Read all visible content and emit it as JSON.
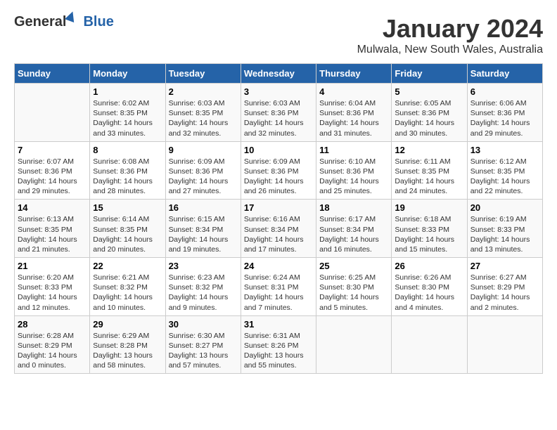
{
  "header": {
    "logo_general": "General",
    "logo_blue": "Blue",
    "title": "January 2024",
    "subtitle": "Mulwala, New South Wales, Australia"
  },
  "columns": [
    "Sunday",
    "Monday",
    "Tuesday",
    "Wednesday",
    "Thursday",
    "Friday",
    "Saturday"
  ],
  "weeks": [
    [
      {
        "day": "",
        "info": ""
      },
      {
        "day": "1",
        "info": "Sunrise: 6:02 AM\nSunset: 8:35 PM\nDaylight: 14 hours\nand 33 minutes."
      },
      {
        "day": "2",
        "info": "Sunrise: 6:03 AM\nSunset: 8:35 PM\nDaylight: 14 hours\nand 32 minutes."
      },
      {
        "day": "3",
        "info": "Sunrise: 6:03 AM\nSunset: 8:36 PM\nDaylight: 14 hours\nand 32 minutes."
      },
      {
        "day": "4",
        "info": "Sunrise: 6:04 AM\nSunset: 8:36 PM\nDaylight: 14 hours\nand 31 minutes."
      },
      {
        "day": "5",
        "info": "Sunrise: 6:05 AM\nSunset: 8:36 PM\nDaylight: 14 hours\nand 30 minutes."
      },
      {
        "day": "6",
        "info": "Sunrise: 6:06 AM\nSunset: 8:36 PM\nDaylight: 14 hours\nand 29 minutes."
      }
    ],
    [
      {
        "day": "7",
        "info": "Sunrise: 6:07 AM\nSunset: 8:36 PM\nDaylight: 14 hours\nand 29 minutes."
      },
      {
        "day": "8",
        "info": "Sunrise: 6:08 AM\nSunset: 8:36 PM\nDaylight: 14 hours\nand 28 minutes."
      },
      {
        "day": "9",
        "info": "Sunrise: 6:09 AM\nSunset: 8:36 PM\nDaylight: 14 hours\nand 27 minutes."
      },
      {
        "day": "10",
        "info": "Sunrise: 6:09 AM\nSunset: 8:36 PM\nDaylight: 14 hours\nand 26 minutes."
      },
      {
        "day": "11",
        "info": "Sunrise: 6:10 AM\nSunset: 8:36 PM\nDaylight: 14 hours\nand 25 minutes."
      },
      {
        "day": "12",
        "info": "Sunrise: 6:11 AM\nSunset: 8:35 PM\nDaylight: 14 hours\nand 24 minutes."
      },
      {
        "day": "13",
        "info": "Sunrise: 6:12 AM\nSunset: 8:35 PM\nDaylight: 14 hours\nand 22 minutes."
      }
    ],
    [
      {
        "day": "14",
        "info": "Sunrise: 6:13 AM\nSunset: 8:35 PM\nDaylight: 14 hours\nand 21 minutes."
      },
      {
        "day": "15",
        "info": "Sunrise: 6:14 AM\nSunset: 8:35 PM\nDaylight: 14 hours\nand 20 minutes."
      },
      {
        "day": "16",
        "info": "Sunrise: 6:15 AM\nSunset: 8:34 PM\nDaylight: 14 hours\nand 19 minutes."
      },
      {
        "day": "17",
        "info": "Sunrise: 6:16 AM\nSunset: 8:34 PM\nDaylight: 14 hours\nand 17 minutes."
      },
      {
        "day": "18",
        "info": "Sunrise: 6:17 AM\nSunset: 8:34 PM\nDaylight: 14 hours\nand 16 minutes."
      },
      {
        "day": "19",
        "info": "Sunrise: 6:18 AM\nSunset: 8:33 PM\nDaylight: 14 hours\nand 15 minutes."
      },
      {
        "day": "20",
        "info": "Sunrise: 6:19 AM\nSunset: 8:33 PM\nDaylight: 14 hours\nand 13 minutes."
      }
    ],
    [
      {
        "day": "21",
        "info": "Sunrise: 6:20 AM\nSunset: 8:33 PM\nDaylight: 14 hours\nand 12 minutes."
      },
      {
        "day": "22",
        "info": "Sunrise: 6:21 AM\nSunset: 8:32 PM\nDaylight: 14 hours\nand 10 minutes."
      },
      {
        "day": "23",
        "info": "Sunrise: 6:23 AM\nSunset: 8:32 PM\nDaylight: 14 hours\nand 9 minutes."
      },
      {
        "day": "24",
        "info": "Sunrise: 6:24 AM\nSunset: 8:31 PM\nDaylight: 14 hours\nand 7 minutes."
      },
      {
        "day": "25",
        "info": "Sunrise: 6:25 AM\nSunset: 8:30 PM\nDaylight: 14 hours\nand 5 minutes."
      },
      {
        "day": "26",
        "info": "Sunrise: 6:26 AM\nSunset: 8:30 PM\nDaylight: 14 hours\nand 4 minutes."
      },
      {
        "day": "27",
        "info": "Sunrise: 6:27 AM\nSunset: 8:29 PM\nDaylight: 14 hours\nand 2 minutes."
      }
    ],
    [
      {
        "day": "28",
        "info": "Sunrise: 6:28 AM\nSunset: 8:29 PM\nDaylight: 14 hours\nand 0 minutes."
      },
      {
        "day": "29",
        "info": "Sunrise: 6:29 AM\nSunset: 8:28 PM\nDaylight: 13 hours\nand 58 minutes."
      },
      {
        "day": "30",
        "info": "Sunrise: 6:30 AM\nSunset: 8:27 PM\nDaylight: 13 hours\nand 57 minutes."
      },
      {
        "day": "31",
        "info": "Sunrise: 6:31 AM\nSunset: 8:26 PM\nDaylight: 13 hours\nand 55 minutes."
      },
      {
        "day": "",
        "info": ""
      },
      {
        "day": "",
        "info": ""
      },
      {
        "day": "",
        "info": ""
      }
    ]
  ]
}
